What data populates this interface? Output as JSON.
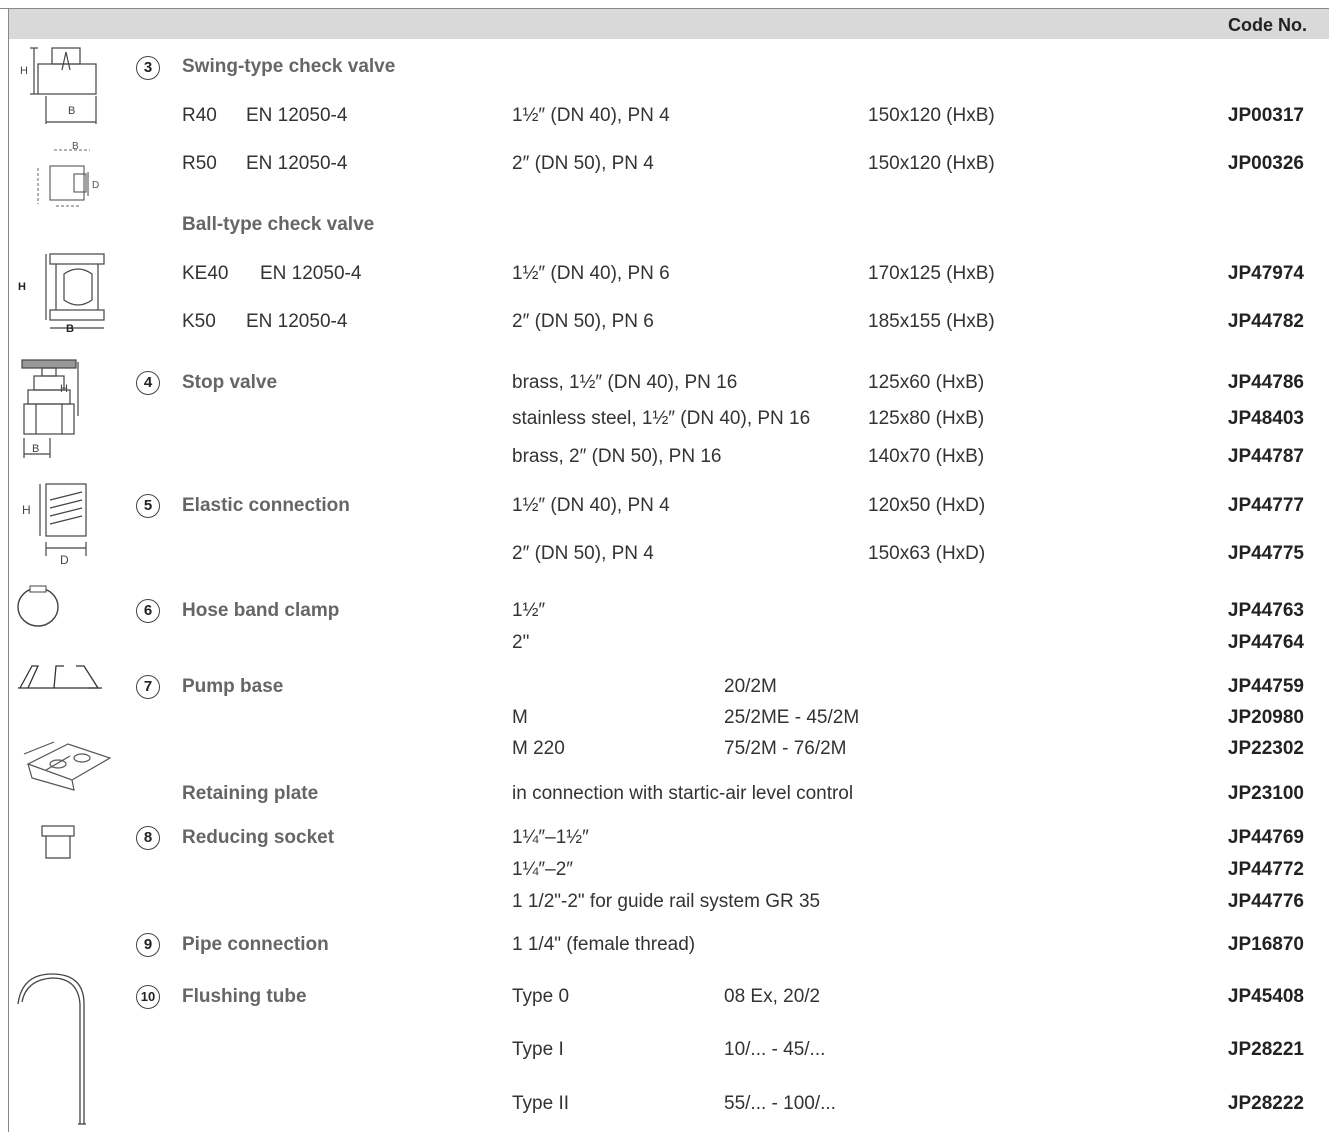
{
  "header": {
    "code_label": "Code No."
  },
  "s3": {
    "num": "3",
    "title": "Swing-type check valve",
    "rows": [
      {
        "model": "R40",
        "std": "EN 12050-4",
        "spec": "1½″ (DN 40), PN 4",
        "dim": "150x120 (HxB)",
        "code": "JP00317"
      },
      {
        "model": "R50",
        "std": "EN 12050-4",
        "spec": "2″ (DN 50), PN 4",
        "dim": "150x120 (HxB)",
        "code": "JP00326"
      }
    ],
    "sub_title": "Ball-type check valve",
    "sub_rows": [
      {
        "model": "KE40",
        "std": "EN 12050-4",
        "spec": "1½″ (DN 40), PN 6",
        "dim": "170x125 (HxB)",
        "code": "JP47974"
      },
      {
        "model": "K50",
        "std": "EN 12050-4",
        "spec": "2″ (DN 50), PN 6",
        "dim": "185x155 (HxB)",
        "code": "JP44782"
      }
    ]
  },
  "s4": {
    "num": "4",
    "title": "Stop valve",
    "rows": [
      {
        "spec": "brass, 1½″ (DN 40), PN 16",
        "dim": "125x60 (HxB)",
        "code": "JP44786"
      },
      {
        "spec": "stainless steel, 1½″ (DN 40), PN 16",
        "dim": "125x80 (HxB)",
        "code": "JP48403"
      },
      {
        "spec": "brass, 2″ (DN 50), PN 16",
        "dim": "140x70 (HxB)",
        "code": "JP44787"
      }
    ]
  },
  "s5": {
    "num": "5",
    "title": "Elastic connection",
    "rows": [
      {
        "spec": "1½″ (DN 40), PN 4",
        "dim": "120x50 (HxD)",
        "code": "JP44777"
      },
      {
        "spec": "2″ (DN 50), PN 4",
        "dim": "150x63 (HxD)",
        "code": "JP44775"
      }
    ]
  },
  "s6": {
    "num": "6",
    "title": "Hose band clamp",
    "rows": [
      {
        "spec": "1½″",
        "code": "JP44763"
      },
      {
        "spec": "2\"",
        "code": "JP44764"
      }
    ]
  },
  "s7": {
    "num": "7",
    "title": "Pump base",
    "rows": [
      {
        "spec": "",
        "models": "20/2M",
        "code": "JP44759"
      },
      {
        "spec": "M",
        "models": "25/2ME - 45/2M",
        "code": "JP20980"
      },
      {
        "spec": "M 220",
        "models": "75/2M - 76/2M",
        "code": "JP22302"
      }
    ],
    "sub_title": "Retaining plate",
    "sub_spec": "in connection with startic-air level control",
    "sub_code": "JP23100"
  },
  "s8": {
    "num": "8",
    "title": "Reducing socket",
    "rows": [
      {
        "spec": "1¼″–1½″",
        "code": "JP44769"
      },
      {
        "spec": "1¼″–2″",
        "code": "JP44772"
      },
      {
        "spec": "1 1/2\"-2\" for guide rail system GR 35",
        "code": "JP44776"
      }
    ]
  },
  "s9": {
    "num": "9",
    "title": "Pipe connection",
    "spec": "1 1/4\" (female thread)",
    "code": "JP16870"
  },
  "s10": {
    "num": "10",
    "title": "Flushing tube",
    "rows": [
      {
        "type": "Type 0",
        "models": "08 Ex, 20/2",
        "code": "JP45408"
      },
      {
        "type": "Type I",
        "models": "10/... - 45/...",
        "code": "JP28221"
      },
      {
        "type": "Type II",
        "models": "55/... - 100/...",
        "code": "JP28222"
      }
    ]
  },
  "icons": {
    "dim_h": "H",
    "dim_b": "B",
    "dim_d": "D"
  }
}
